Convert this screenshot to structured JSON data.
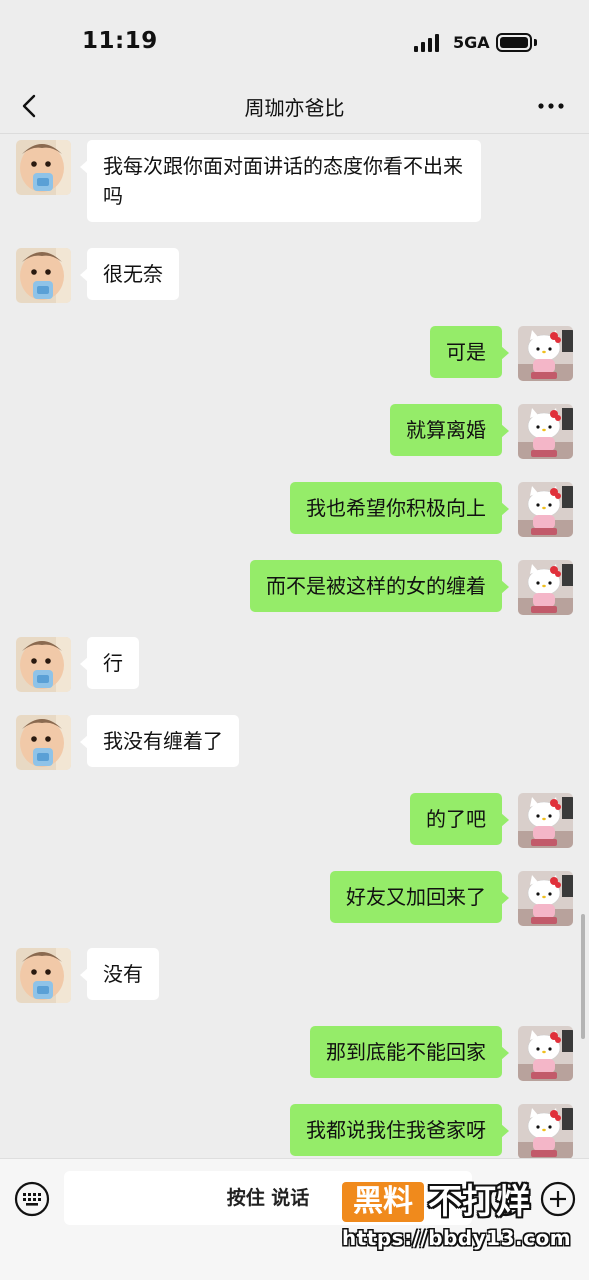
{
  "status_bar": {
    "time": "11:19",
    "network": "5GA",
    "battery_level": 1.0
  },
  "nav": {
    "title": "周珈亦爸比"
  },
  "icons": {
    "back": "chevron-left-icon",
    "more": "more-dots-icon",
    "keyboard": "keyboard-icon",
    "emoji": "emoji-icon",
    "plus": "plus-icon",
    "contact_avatar": "baby-avatar",
    "self_avatar": "hello-kitty-avatar"
  },
  "colors": {
    "sent_bubble": "#95ec69",
    "received_bubble": "#ffffff",
    "background": "#ededed"
  },
  "messages": [
    {
      "from": "contact",
      "text": "我每次跟你面对面讲话的态度你看不出来吗"
    },
    {
      "from": "contact",
      "text": "很无奈"
    },
    {
      "from": "me",
      "text": "可是"
    },
    {
      "from": "me",
      "text": "就算离婚"
    },
    {
      "from": "me",
      "text": "我也希望你积极向上"
    },
    {
      "from": "me",
      "text": "而不是被这样的女的缠着"
    },
    {
      "from": "contact",
      "text": "行"
    },
    {
      "from": "contact",
      "text": "我没有缠着了"
    },
    {
      "from": "me",
      "text": "的了吧"
    },
    {
      "from": "me",
      "text": "好友又加回来了"
    },
    {
      "from": "contact",
      "text": "没有"
    },
    {
      "from": "me",
      "text": "那到底能不能回家"
    },
    {
      "from": "me",
      "text": "我都说我住我爸家呀"
    }
  ],
  "input_bar": {
    "voice_label": "按住 说话"
  },
  "watermark": {
    "badge": "黑料",
    "text": "不打烊",
    "url": "https://bbdy13.com"
  }
}
